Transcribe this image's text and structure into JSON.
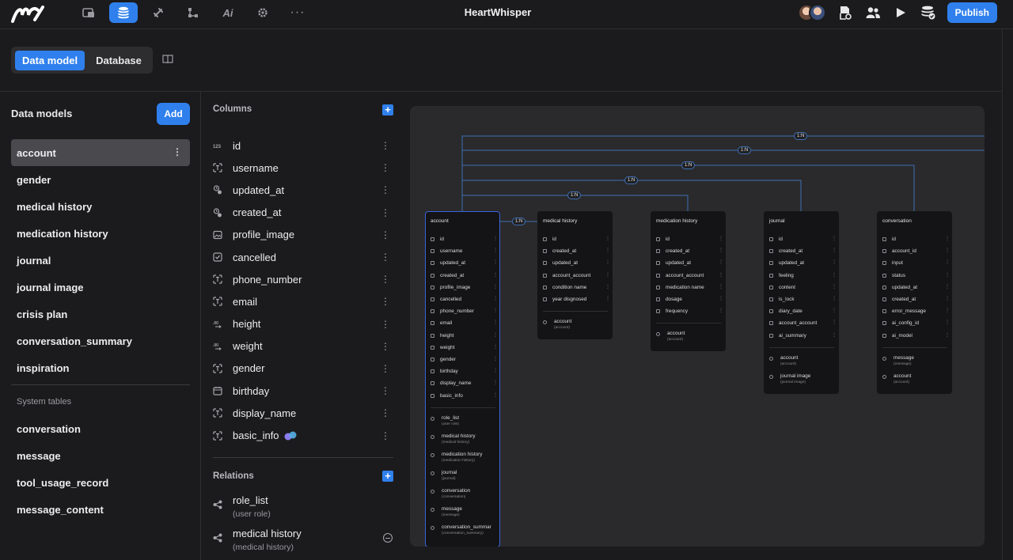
{
  "app": {
    "title": "HeartWhisper",
    "publish": "Publish",
    "nav_icons": [
      "pages-icon",
      "data-icon",
      "plugin-icon",
      "workflow-icon",
      "ai-icon",
      "settings-icon",
      "more-icon"
    ],
    "right_icons": [
      "doc-settings-icon",
      "users-icon",
      "play-icon",
      "database-check-icon"
    ]
  },
  "modes": {
    "data_model": "Data model",
    "database": "Database"
  },
  "models": {
    "title": "Data models",
    "add": "Add",
    "items": [
      "account",
      "gender",
      "medical history",
      "medication history",
      "journal",
      "journal image",
      "crisis plan",
      "conversation_summary",
      "inspiration"
    ],
    "system_label": "System tables",
    "system_items": [
      "conversation",
      "message",
      "tool_usage_record",
      "message_content"
    ]
  },
  "columns": {
    "title": "Columns",
    "items": [
      {
        "name": "id",
        "type": "number-icon"
      },
      {
        "name": "username",
        "type": "text-icon"
      },
      {
        "name": "updated_at",
        "type": "datetime-icon"
      },
      {
        "name": "created_at",
        "type": "datetime-icon"
      },
      {
        "name": "profile_image",
        "type": "image-icon"
      },
      {
        "name": "cancelled",
        "type": "checkbox-icon"
      },
      {
        "name": "phone_number",
        "type": "text-icon"
      },
      {
        "name": "email",
        "type": "text-icon"
      },
      {
        "name": "height",
        "type": "decimal-icon"
      },
      {
        "name": "weight",
        "type": "decimal-icon"
      },
      {
        "name": "gender",
        "type": "text-icon"
      },
      {
        "name": "birthday",
        "type": "date-icon"
      },
      {
        "name": "display_name",
        "type": "text-icon"
      },
      {
        "name": "basic_info",
        "type": "text-icon",
        "badge": true
      }
    ],
    "relations_title": "Relations",
    "relations": [
      {
        "name": "role_list",
        "target": "(user role)"
      },
      {
        "name": "medical history",
        "target": "(medical history)"
      }
    ]
  },
  "diagram": {
    "edge_label": "1:N",
    "edge_labels": [
      "1:N",
      "1:N",
      "1:N",
      "1:N",
      "1:N",
      "1:N"
    ],
    "tables": [
      {
        "name": "account",
        "fields": [
          "id",
          "username",
          "updated_at",
          "created_at",
          "profile_image",
          "cancelled",
          "phone_number",
          "email",
          "height",
          "weight",
          "gender",
          "birthday",
          "display_name",
          "basic_info"
        ],
        "relations": [
          {
            "name": "role_list",
            "target": "(user role)"
          },
          {
            "name": "medical history",
            "target": "(medical history)"
          },
          {
            "name": "medication history",
            "target": "(medication history)"
          },
          {
            "name": "journal",
            "target": "(journal)"
          },
          {
            "name": "conversation",
            "target": "(conversation)"
          },
          {
            "name": "message",
            "target": "(message)"
          },
          {
            "name": "conversation_summar",
            "target": "(conversation_summary)"
          }
        ]
      },
      {
        "name": "medical history",
        "fields": [
          "id",
          "created_at",
          "updated_at",
          "account_account",
          "condition name",
          "year disgnosed"
        ],
        "relations": [
          {
            "name": "account",
            "target": "(account)"
          }
        ]
      },
      {
        "name": "medication history",
        "fields": [
          "id",
          "created_at",
          "updated_at",
          "account_account",
          "medication name",
          "dosage",
          "frequency"
        ],
        "relations": [
          {
            "name": "account",
            "target": "(account)"
          }
        ]
      },
      {
        "name": "journal",
        "fields": [
          "id",
          "created_at",
          "updated_at",
          "feeling",
          "content",
          "is_lock",
          "diary_date",
          "account_account",
          "ai_summary"
        ],
        "relations": [
          {
            "name": "account",
            "target": "(account)"
          },
          {
            "name": "journal image",
            "target": "(journal image)"
          }
        ]
      },
      {
        "name": "conversation",
        "fields": [
          "id",
          "account_id",
          "input",
          "status",
          "updated_at",
          "created_at",
          "error_message",
          "ai_config_id",
          "ai_model"
        ],
        "relations": [
          {
            "name": "message",
            "target": "(message)"
          },
          {
            "name": "account",
            "target": "(account)"
          }
        ]
      }
    ]
  }
}
